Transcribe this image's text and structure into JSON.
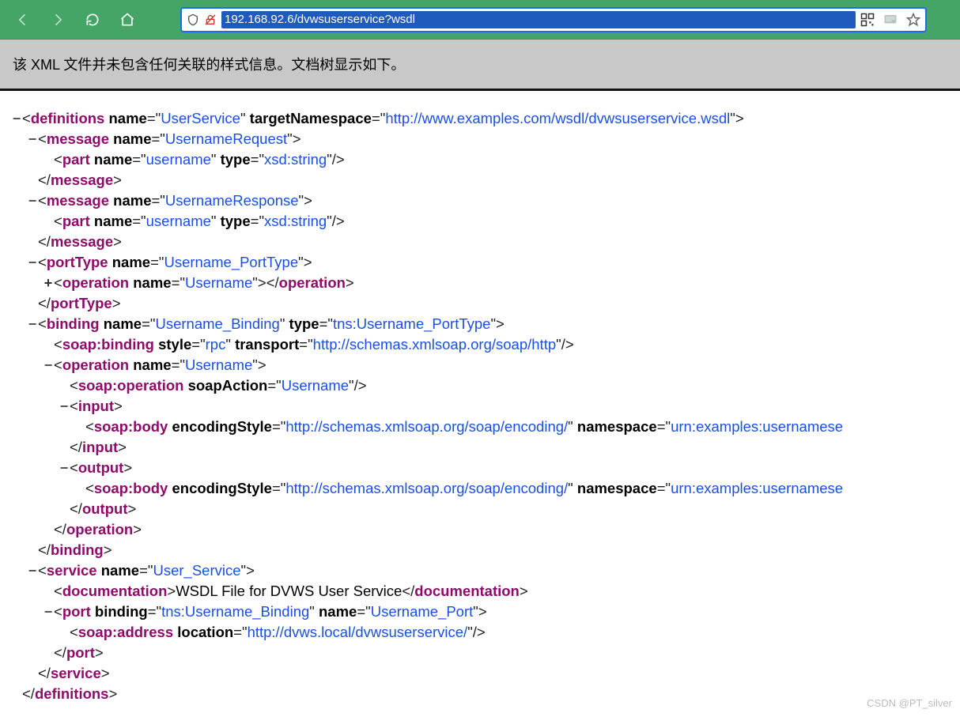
{
  "toolbar": {
    "url": "192.168.92.6/dvwsuserservice?wsdl"
  },
  "banner": {
    "message": "该 XML 文件并未包含任何关联的样式信息。文档树显示如下。"
  },
  "watermark": "CSDN @PT_silver",
  "xml": {
    "rows": [
      {
        "ind": 0,
        "tw": "−",
        "seg": [
          [
            "p",
            "<"
          ],
          [
            "tag",
            "definitions"
          ],
          [
            "p",
            " "
          ],
          [
            "attr",
            "name"
          ],
          [
            "p",
            "="
          ],
          [
            "p",
            "\""
          ],
          [
            "val",
            "UserService"
          ],
          [
            "p",
            "\""
          ],
          [
            "p",
            " "
          ],
          [
            "attr",
            "targetNamespace"
          ],
          [
            "p",
            "="
          ],
          [
            "p",
            "\""
          ],
          [
            "val",
            "http://www.examples.com/wsdl/dvwsuserservice.wsdl"
          ],
          [
            "p",
            "\""
          ],
          [
            "p",
            ">"
          ]
        ]
      },
      {
        "ind": 1,
        "tw": "−",
        "seg": [
          [
            "p",
            "<"
          ],
          [
            "tag",
            "message"
          ],
          [
            "p",
            " "
          ],
          [
            "attr",
            "name"
          ],
          [
            "p",
            "="
          ],
          [
            "p",
            "\""
          ],
          [
            "val",
            "UsernameRequest"
          ],
          [
            "p",
            "\""
          ],
          [
            "p",
            ">"
          ]
        ]
      },
      {
        "ind": 2,
        "tw": "",
        "seg": [
          [
            "p",
            "<"
          ],
          [
            "tag",
            "part"
          ],
          [
            "p",
            " "
          ],
          [
            "attr",
            "name"
          ],
          [
            "p",
            "="
          ],
          [
            "p",
            "\""
          ],
          [
            "val",
            "username"
          ],
          [
            "p",
            "\""
          ],
          [
            "p",
            " "
          ],
          [
            "attr",
            "type"
          ],
          [
            "p",
            "="
          ],
          [
            "p",
            "\""
          ],
          [
            "val",
            "xsd:string"
          ],
          [
            "p",
            "\""
          ],
          [
            "p",
            "/>"
          ]
        ]
      },
      {
        "ind": 1,
        "tw": "",
        "seg": [
          [
            "p",
            "</"
          ],
          [
            "tag",
            "message"
          ],
          [
            "p",
            ">"
          ]
        ]
      },
      {
        "ind": 1,
        "tw": "−",
        "seg": [
          [
            "p",
            "<"
          ],
          [
            "tag",
            "message"
          ],
          [
            "p",
            " "
          ],
          [
            "attr",
            "name"
          ],
          [
            "p",
            "="
          ],
          [
            "p",
            "\""
          ],
          [
            "val",
            "UsernameResponse"
          ],
          [
            "p",
            "\""
          ],
          [
            "p",
            ">"
          ]
        ]
      },
      {
        "ind": 2,
        "tw": "",
        "seg": [
          [
            "p",
            "<"
          ],
          [
            "tag",
            "part"
          ],
          [
            "p",
            " "
          ],
          [
            "attr",
            "name"
          ],
          [
            "p",
            "="
          ],
          [
            "p",
            "\""
          ],
          [
            "val",
            "username"
          ],
          [
            "p",
            "\""
          ],
          [
            "p",
            " "
          ],
          [
            "attr",
            "type"
          ],
          [
            "p",
            "="
          ],
          [
            "p",
            "\""
          ],
          [
            "val",
            "xsd:string"
          ],
          [
            "p",
            "\""
          ],
          [
            "p",
            "/>"
          ]
        ]
      },
      {
        "ind": 1,
        "tw": "",
        "seg": [
          [
            "p",
            "</"
          ],
          [
            "tag",
            "message"
          ],
          [
            "p",
            ">"
          ]
        ]
      },
      {
        "ind": 1,
        "tw": "−",
        "seg": [
          [
            "p",
            "<"
          ],
          [
            "tag",
            "portType"
          ],
          [
            "p",
            " "
          ],
          [
            "attr",
            "name"
          ],
          [
            "p",
            "="
          ],
          [
            "p",
            "\""
          ],
          [
            "val",
            "Username_PortType"
          ],
          [
            "p",
            "\""
          ],
          [
            "p",
            ">"
          ]
        ]
      },
      {
        "ind": 2,
        "tw": "+",
        "seg": [
          [
            "p",
            "<"
          ],
          [
            "tag",
            "operation"
          ],
          [
            "p",
            " "
          ],
          [
            "attr",
            "name"
          ],
          [
            "p",
            "="
          ],
          [
            "p",
            "\""
          ],
          [
            "val",
            "Username"
          ],
          [
            "p",
            "\""
          ],
          [
            "p",
            ">"
          ],
          [
            "p",
            "</"
          ],
          [
            "tag",
            "operation"
          ],
          [
            "p",
            ">"
          ]
        ]
      },
      {
        "ind": 1,
        "tw": "",
        "seg": [
          [
            "p",
            "</"
          ],
          [
            "tag",
            "portType"
          ],
          [
            "p",
            ">"
          ]
        ]
      },
      {
        "ind": 1,
        "tw": "−",
        "seg": [
          [
            "p",
            "<"
          ],
          [
            "tag",
            "binding"
          ],
          [
            "p",
            " "
          ],
          [
            "attr",
            "name"
          ],
          [
            "p",
            "="
          ],
          [
            "p",
            "\""
          ],
          [
            "val",
            "Username_Binding"
          ],
          [
            "p",
            "\""
          ],
          [
            "p",
            " "
          ],
          [
            "attr",
            "type"
          ],
          [
            "p",
            "="
          ],
          [
            "p",
            "\""
          ],
          [
            "val",
            "tns:Username_PortType"
          ],
          [
            "p",
            "\""
          ],
          [
            "p",
            ">"
          ]
        ]
      },
      {
        "ind": 2,
        "tw": "",
        "seg": [
          [
            "p",
            "<"
          ],
          [
            "tag",
            "soap:binding"
          ],
          [
            "p",
            " "
          ],
          [
            "attr",
            "style"
          ],
          [
            "p",
            "="
          ],
          [
            "p",
            "\""
          ],
          [
            "val",
            "rpc"
          ],
          [
            "p",
            "\""
          ],
          [
            "p",
            " "
          ],
          [
            "attr",
            "transport"
          ],
          [
            "p",
            "="
          ],
          [
            "p",
            "\""
          ],
          [
            "val",
            "http://schemas.xmlsoap.org/soap/http"
          ],
          [
            "p",
            "\""
          ],
          [
            "p",
            "/>"
          ]
        ]
      },
      {
        "ind": 2,
        "tw": "−",
        "seg": [
          [
            "p",
            "<"
          ],
          [
            "tag",
            "operation"
          ],
          [
            "p",
            " "
          ],
          [
            "attr",
            "name"
          ],
          [
            "p",
            "="
          ],
          [
            "p",
            "\""
          ],
          [
            "val",
            "Username"
          ],
          [
            "p",
            "\""
          ],
          [
            "p",
            ">"
          ]
        ]
      },
      {
        "ind": 3,
        "tw": "",
        "seg": [
          [
            "p",
            "<"
          ],
          [
            "tag",
            "soap:operation"
          ],
          [
            "p",
            " "
          ],
          [
            "attr",
            "soapAction"
          ],
          [
            "p",
            "="
          ],
          [
            "p",
            "\""
          ],
          [
            "val",
            "Username"
          ],
          [
            "p",
            "\""
          ],
          [
            "p",
            "/>"
          ]
        ]
      },
      {
        "ind": 3,
        "tw": "−",
        "seg": [
          [
            "p",
            "<"
          ],
          [
            "tag",
            "input"
          ],
          [
            "p",
            ">"
          ]
        ]
      },
      {
        "ind": 4,
        "tw": "",
        "seg": [
          [
            "p",
            "<"
          ],
          [
            "tag",
            "soap:body"
          ],
          [
            "p",
            " "
          ],
          [
            "attr",
            "encodingStyle"
          ],
          [
            "p",
            "="
          ],
          [
            "p",
            "\""
          ],
          [
            "val",
            "http://schemas.xmlsoap.org/soap/encoding/"
          ],
          [
            "p",
            "\""
          ],
          [
            "p",
            " "
          ],
          [
            "attr",
            "namespace"
          ],
          [
            "p",
            "="
          ],
          [
            "p",
            "\""
          ],
          [
            "val",
            "urn:examples:usernamese"
          ]
        ]
      },
      {
        "ind": 3,
        "tw": "",
        "seg": [
          [
            "p",
            "</"
          ],
          [
            "tag",
            "input"
          ],
          [
            "p",
            ">"
          ]
        ]
      },
      {
        "ind": 3,
        "tw": "−",
        "seg": [
          [
            "p",
            "<"
          ],
          [
            "tag",
            "output"
          ],
          [
            "p",
            ">"
          ]
        ]
      },
      {
        "ind": 4,
        "tw": "",
        "seg": [
          [
            "p",
            "<"
          ],
          [
            "tag",
            "soap:body"
          ],
          [
            "p",
            " "
          ],
          [
            "attr",
            "encodingStyle"
          ],
          [
            "p",
            "="
          ],
          [
            "p",
            "\""
          ],
          [
            "val",
            "http://schemas.xmlsoap.org/soap/encoding/"
          ],
          [
            "p",
            "\""
          ],
          [
            "p",
            " "
          ],
          [
            "attr",
            "namespace"
          ],
          [
            "p",
            "="
          ],
          [
            "p",
            "\""
          ],
          [
            "val",
            "urn:examples:usernamese"
          ]
        ]
      },
      {
        "ind": 3,
        "tw": "",
        "seg": [
          [
            "p",
            "</"
          ],
          [
            "tag",
            "output"
          ],
          [
            "p",
            ">"
          ]
        ]
      },
      {
        "ind": 2,
        "tw": "",
        "seg": [
          [
            "p",
            "</"
          ],
          [
            "tag",
            "operation"
          ],
          [
            "p",
            ">"
          ]
        ]
      },
      {
        "ind": 1,
        "tw": "",
        "seg": [
          [
            "p",
            "</"
          ],
          [
            "tag",
            "binding"
          ],
          [
            "p",
            ">"
          ]
        ]
      },
      {
        "ind": 1,
        "tw": "−",
        "seg": [
          [
            "p",
            "<"
          ],
          [
            "tag",
            "service"
          ],
          [
            "p",
            " "
          ],
          [
            "attr",
            "name"
          ],
          [
            "p",
            "="
          ],
          [
            "p",
            "\""
          ],
          [
            "val",
            "User_Service"
          ],
          [
            "p",
            "\""
          ],
          [
            "p",
            ">"
          ]
        ]
      },
      {
        "ind": 2,
        "tw": "",
        "seg": [
          [
            "p",
            "<"
          ],
          [
            "tag",
            "documentation"
          ],
          [
            "p",
            ">"
          ],
          [
            "txt",
            "WSDL File for DVWS User Service"
          ],
          [
            "p",
            "</"
          ],
          [
            "tag",
            "documentation"
          ],
          [
            "p",
            ">"
          ]
        ]
      },
      {
        "ind": 2,
        "tw": "−",
        "seg": [
          [
            "p",
            "<"
          ],
          [
            "tag",
            "port"
          ],
          [
            "p",
            " "
          ],
          [
            "attr",
            "binding"
          ],
          [
            "p",
            "="
          ],
          [
            "p",
            "\""
          ],
          [
            "val",
            "tns:Username_Binding"
          ],
          [
            "p",
            "\""
          ],
          [
            "p",
            " "
          ],
          [
            "attr",
            "name"
          ],
          [
            "p",
            "="
          ],
          [
            "p",
            "\""
          ],
          [
            "val",
            "Username_Port"
          ],
          [
            "p",
            "\""
          ],
          [
            "p",
            ">"
          ]
        ]
      },
      {
        "ind": 3,
        "tw": "",
        "seg": [
          [
            "p",
            "<"
          ],
          [
            "tag",
            "soap:address"
          ],
          [
            "p",
            " "
          ],
          [
            "attr",
            "location"
          ],
          [
            "p",
            "="
          ],
          [
            "p",
            "\""
          ],
          [
            "val",
            "http://dvws.local/dvwsuserservice/"
          ],
          [
            "p",
            "\""
          ],
          [
            "p",
            "/>"
          ]
        ]
      },
      {
        "ind": 2,
        "tw": "",
        "seg": [
          [
            "p",
            "</"
          ],
          [
            "tag",
            "port"
          ],
          [
            "p",
            ">"
          ]
        ]
      },
      {
        "ind": 1,
        "tw": "",
        "seg": [
          [
            "p",
            "</"
          ],
          [
            "tag",
            "service"
          ],
          [
            "p",
            ">"
          ]
        ]
      },
      {
        "ind": 0,
        "tw": "",
        "seg": [
          [
            "p",
            "</"
          ],
          [
            "tag",
            "definitions"
          ],
          [
            "p",
            ">"
          ]
        ]
      }
    ]
  }
}
